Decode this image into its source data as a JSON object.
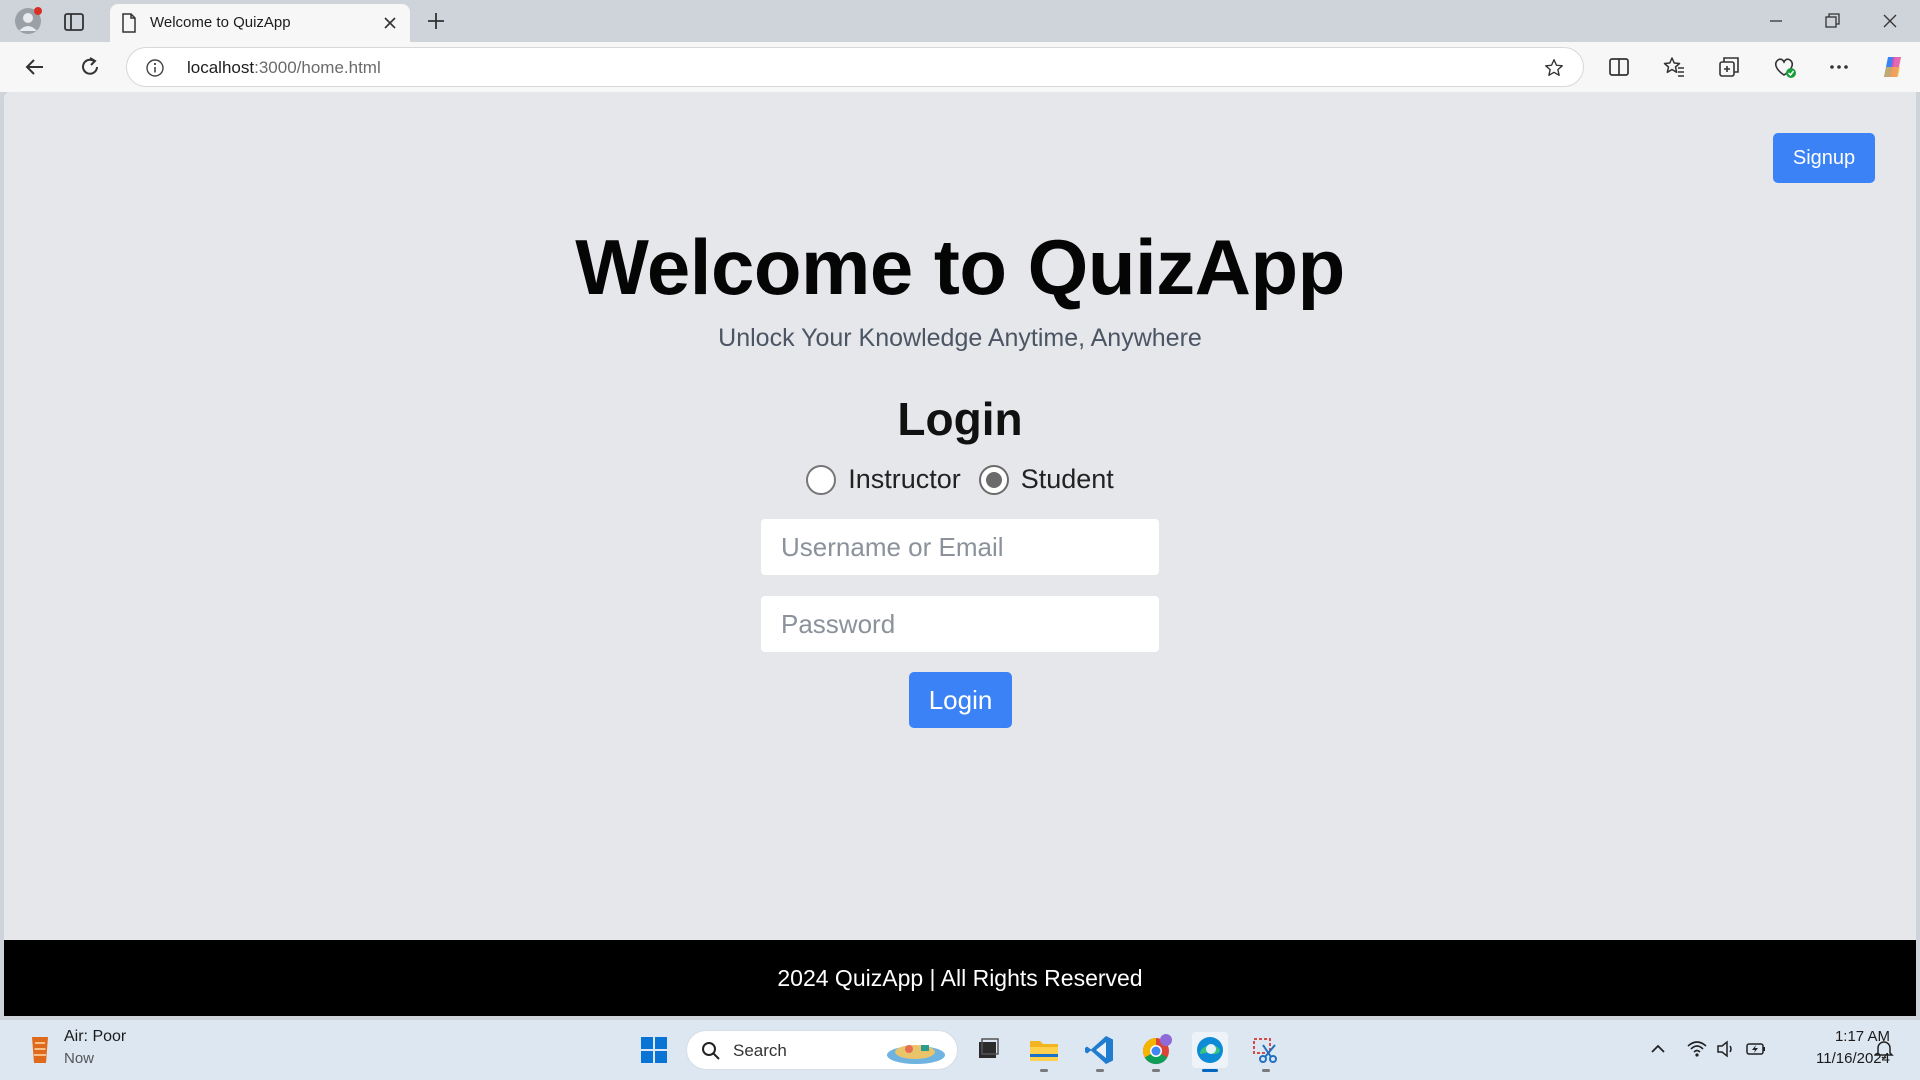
{
  "browser": {
    "tab_title": "Welcome to QuizApp",
    "url_host": "localhost",
    "url_rest": ":3000/home.html",
    "icons": [
      "profile-icon",
      "tab-actions-icon",
      "document-icon",
      "close-icon",
      "new-tab-icon",
      "back-icon",
      "refresh-icon",
      "info-icon",
      "star-icon",
      "split-screen-icon",
      "favorites-icon",
      "collections-icon",
      "browser-essentials-icon",
      "more-icon",
      "copilot-icon",
      "minimize-icon",
      "restore-icon",
      "window-close-icon"
    ]
  },
  "page": {
    "signup_label": "Signup",
    "title": "Welcome to QuizApp",
    "subtitle": "Unlock Your Knowledge Anytime, Anywhere",
    "login_heading": "Login",
    "roles": [
      {
        "label": "Instructor",
        "checked": false
      },
      {
        "label": "Student",
        "checked": true
      }
    ],
    "username_placeholder": "Username or Email",
    "password_placeholder": "Password",
    "login_button": "Login",
    "footer": "2024 QuizApp | All Rights Reserved",
    "colors": {
      "accent": "#3b82f6",
      "background": "#e5e7eb",
      "footer": "#000000"
    }
  },
  "taskbar": {
    "weather_title": "Air: Poor",
    "weather_sub": "Now",
    "search_label": "Search",
    "time": "1:17 AM",
    "date": "11/16/2024",
    "apps": [
      "windows-start-icon",
      "task-view-icon",
      "file-explorer-icon",
      "vscode-icon",
      "chrome-icon",
      "edge-icon",
      "snipping-tool-icon"
    ],
    "tray": [
      "chevron-up-icon",
      "wifi-icon",
      "volume-icon",
      "battery-icon",
      "notification-bell-icon"
    ]
  }
}
